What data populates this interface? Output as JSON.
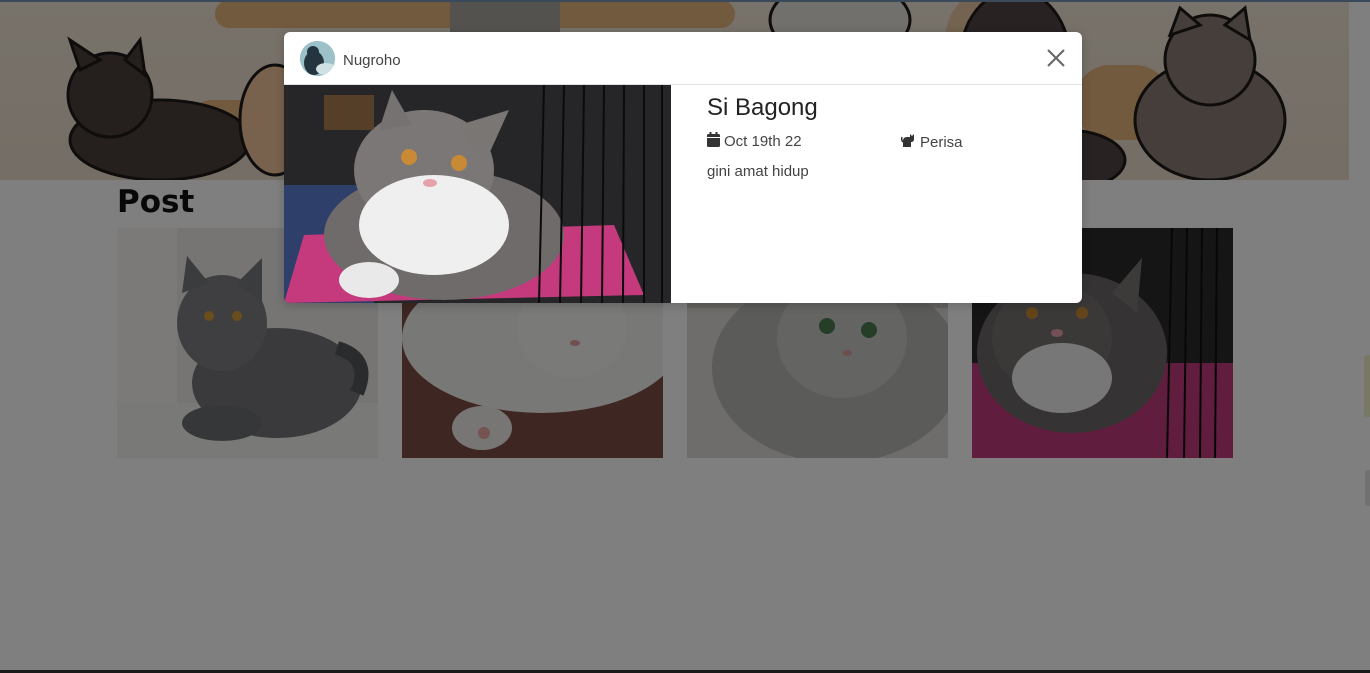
{
  "page": {
    "section_title": "Post",
    "posts": [
      {
        "image": "grey-british-shorthair-photo"
      },
      {
        "image": "white-cat-lying-photo"
      },
      {
        "image": "fluffy-silver-persian-photo"
      },
      {
        "image": "grey-white-cat-in-cage-photo"
      }
    ]
  },
  "modal": {
    "user": {
      "name": "Nugroho",
      "avatar": "user-avatar"
    },
    "post": {
      "name": "Si Bagong",
      "date": "Oct 19th 22",
      "breed": "Perisa",
      "caption": "gini amat hidup",
      "date_icon": "calendar-icon",
      "breed_icon": "cat-icon"
    },
    "close_icon": "close-icon"
  },
  "colors": {
    "overlay": "#000000",
    "modal_bg": "#ffffff",
    "accent_cage_bed": "#c2357a"
  }
}
